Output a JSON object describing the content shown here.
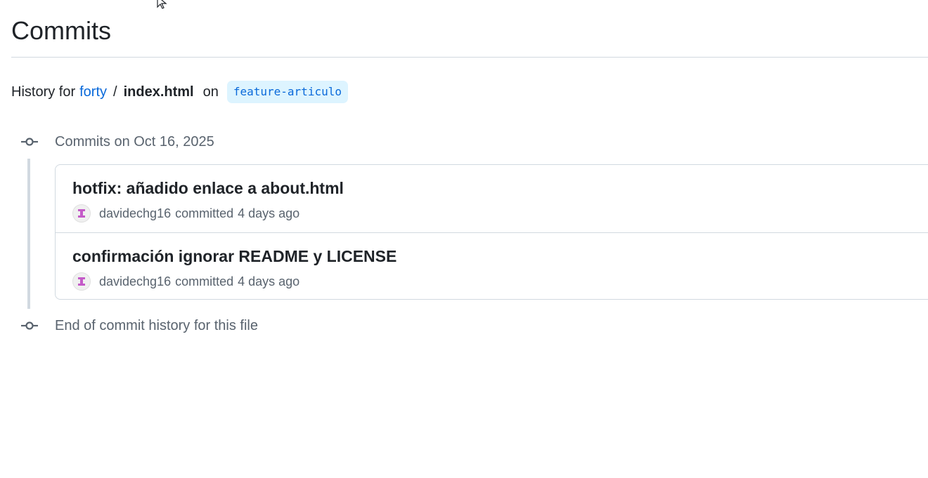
{
  "page": {
    "title": "Commits"
  },
  "history": {
    "prefix": "History for",
    "repo": "forty",
    "separator": "/",
    "file": "index.html",
    "on_text": "on",
    "branch": "feature-articulo"
  },
  "commit_groups": [
    {
      "heading": "Commits on Oct 16, 2025",
      "commits": [
        {
          "title": "hotfix: añadido enlace a about.html",
          "author": "davidechg16",
          "action": "committed",
          "time": "4 days ago"
        },
        {
          "title": "confirmación ignorar README y LICENSE",
          "author": "davidechg16",
          "action": "committed",
          "time": "4 days ago"
        }
      ]
    }
  ],
  "footer": {
    "end_text": "End of commit history for this file"
  },
  "colors": {
    "link": "#0969da",
    "branch_bg": "#ddf4ff",
    "muted_text": "#59636e",
    "border": "#d1d9e0",
    "avatar_glyph": "#c45bc8"
  },
  "icons": {
    "commit_node": "git-commit-icon",
    "avatar": "identicon-avatar",
    "cursor": "mouse-pointer-icon"
  }
}
